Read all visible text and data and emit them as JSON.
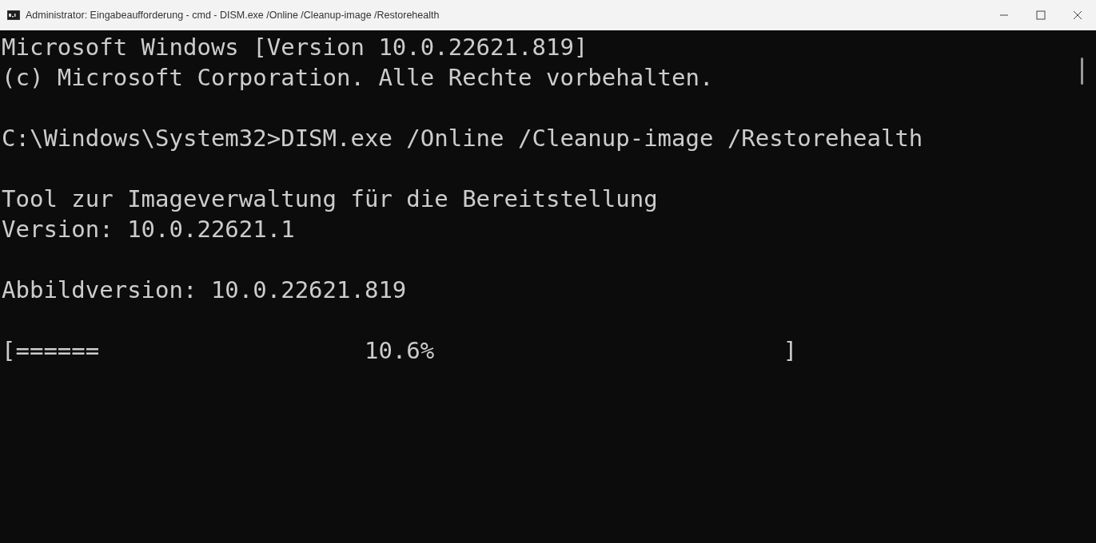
{
  "window": {
    "title": "Administrator: Eingabeaufforderung - cmd - DISM.exe  /Online /Cleanup-image /Restorehealth"
  },
  "console": {
    "blocks": [
      [
        "Microsoft Windows [Version 10.0.22621.819]",
        "(c) Microsoft Corporation. Alle Rechte vorbehalten."
      ],
      [
        "C:\\Windows\\System32>DISM.exe /Online /Cleanup-image /Restorehealth"
      ],
      [
        "Tool zur Imageverwaltung für die Bereitstellung",
        "Version: 10.0.22621.1"
      ],
      [
        "Abbildversion: 10.0.22621.819"
      ],
      [
        "[======                   10.6%                         ]"
      ]
    ]
  }
}
